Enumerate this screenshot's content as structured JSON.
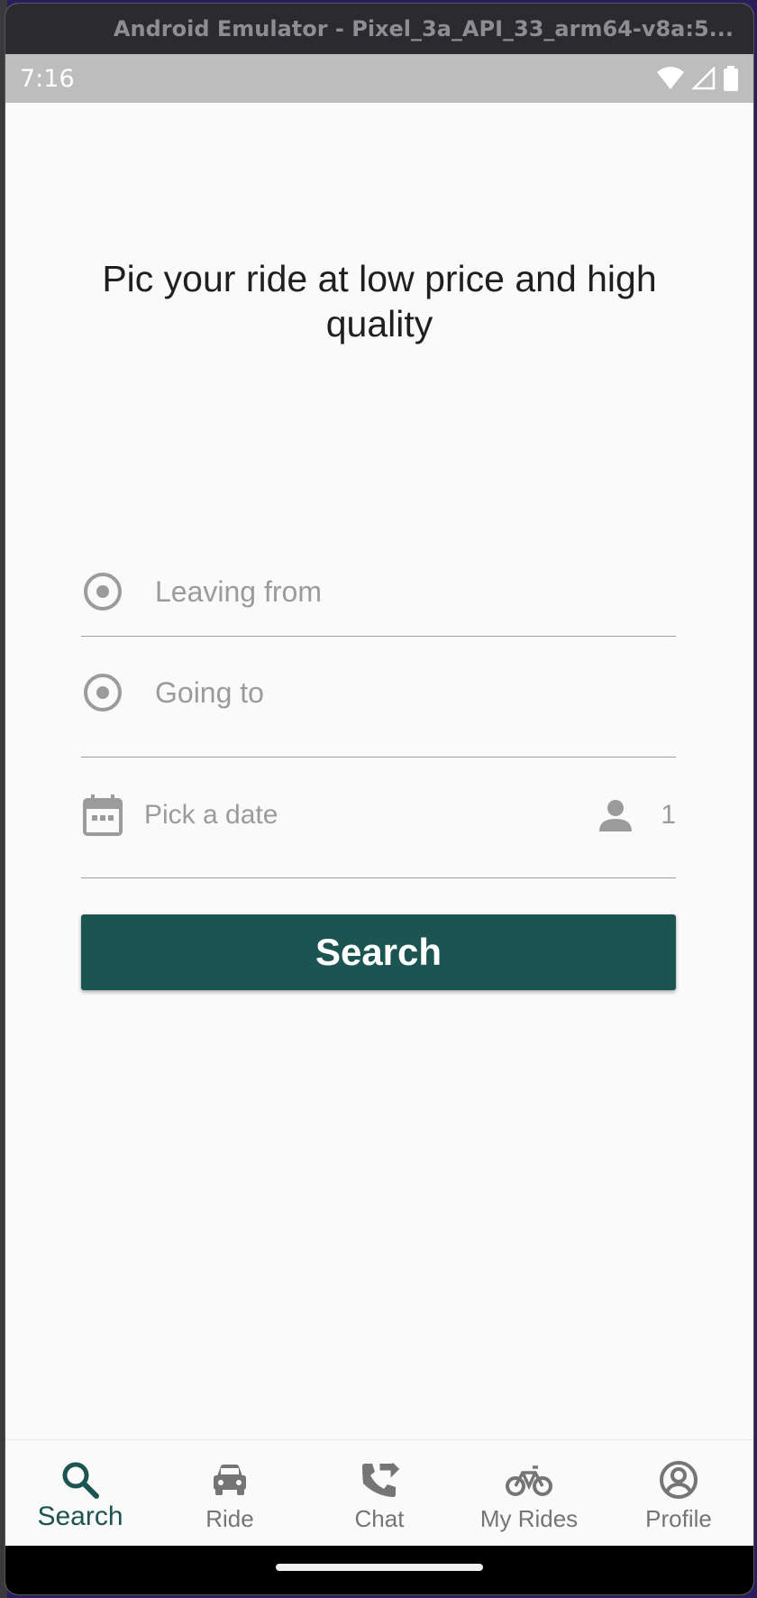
{
  "window": {
    "title": "Android Emulator - Pixel_3a_API_33_arm64-v8a:5..."
  },
  "status_bar": {
    "time": "7:16",
    "icons": [
      "wifi-icon",
      "signal-icon",
      "battery-icon"
    ]
  },
  "headline": "Pic your ride at low price and high quality",
  "form": {
    "leaving_from": {
      "placeholder": "Leaving from",
      "icon": "radio-target-icon"
    },
    "going_to": {
      "placeholder": "Going to",
      "icon": "radio-target-icon"
    },
    "date": {
      "placeholder": "Pick a date",
      "icon": "calendar-icon"
    },
    "passengers": {
      "value": "1",
      "icon": "person-icon"
    }
  },
  "search_button": {
    "label": "Search",
    "color": "#1b5450"
  },
  "bottom_nav": {
    "items": [
      {
        "label": "Search",
        "icon": "search-icon",
        "active": true
      },
      {
        "label": "Ride",
        "icon": "car-icon",
        "active": false
      },
      {
        "label": "Chat",
        "icon": "phone-forward-icon",
        "active": false
      },
      {
        "label": "My Rides",
        "icon": "bicycle-icon",
        "active": false
      },
      {
        "label": "Profile",
        "icon": "account-circle-icon",
        "active": false
      }
    ]
  },
  "colors": {
    "accent": "#1b5450",
    "placeholder": "#9b9b9b",
    "background": "#fafafa",
    "status_bar": "#bdbdbd"
  }
}
